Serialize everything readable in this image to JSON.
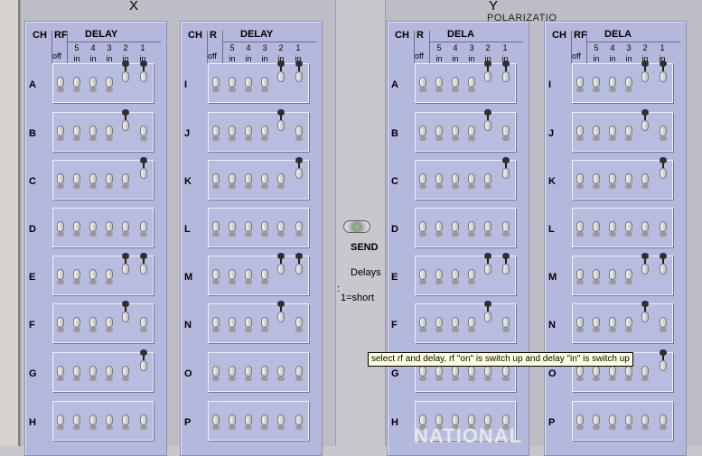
{
  "groups": [
    {
      "title": "X",
      "subtitle": ""
    },
    {
      "title": "Y",
      "subtitle": "POLARIZATIO"
    }
  ],
  "headers": {
    "ch": "CH",
    "off": "off",
    "delay": "DELAY",
    "delay_short": "DELA",
    "in": "in",
    "nums": [
      "5",
      "4",
      "3",
      "2",
      "1"
    ]
  },
  "panels": [
    {
      "rf": "RF",
      "delay": "DELAY",
      "rows": [
        {
          "label": "A",
          "switches": [
            "d",
            "d",
            "d",
            "d",
            "u",
            "u"
          ]
        },
        {
          "label": "B",
          "switches": [
            "d",
            "d",
            "d",
            "d",
            "u",
            "d"
          ]
        },
        {
          "label": "C",
          "switches": [
            "d",
            "d",
            "d",
            "d",
            "d",
            "u"
          ]
        },
        {
          "label": "D",
          "switches": [
            "d",
            "d",
            "d",
            "d",
            "d",
            "d"
          ]
        },
        {
          "label": "E",
          "switches": [
            "d",
            "d",
            "d",
            "d",
            "u",
            "u"
          ]
        },
        {
          "label": "F",
          "switches": [
            "d",
            "d",
            "d",
            "d",
            "u",
            "d"
          ]
        },
        {
          "label": "G",
          "switches": [
            "d",
            "d",
            "d",
            "d",
            "d",
            "u"
          ]
        },
        {
          "label": "H",
          "switches": [
            "d",
            "d",
            "d",
            "d",
            "d",
            "d"
          ]
        }
      ]
    },
    {
      "rf": "R",
      "delay": "DELAY",
      "rows": [
        {
          "label": "I",
          "switches": [
            "d",
            "d",
            "d",
            "d",
            "u",
            "u"
          ]
        },
        {
          "label": "J",
          "switches": [
            "d",
            "d",
            "d",
            "d",
            "u",
            "d"
          ]
        },
        {
          "label": "K",
          "switches": [
            "d",
            "d",
            "d",
            "d",
            "d",
            "u"
          ]
        },
        {
          "label": "L",
          "switches": [
            "d",
            "d",
            "d",
            "d",
            "d",
            "d"
          ]
        },
        {
          "label": "M",
          "switches": [
            "d",
            "d",
            "d",
            "d",
            "u",
            "u"
          ]
        },
        {
          "label": "N",
          "switches": [
            "d",
            "d",
            "d",
            "d",
            "u",
            "d"
          ]
        },
        {
          "label": "O",
          "switches": [
            "d",
            "d",
            "d",
            "d",
            "d",
            "d"
          ]
        },
        {
          "label": "P",
          "switches": [
            "d",
            "d",
            "d",
            "d",
            "d",
            "d"
          ]
        }
      ]
    },
    {
      "rf": "R",
      "delay": "DELA",
      "rows": [
        {
          "label": "A",
          "switches": [
            "d",
            "d",
            "d",
            "d",
            "u",
            "u"
          ]
        },
        {
          "label": "B",
          "switches": [
            "d",
            "d",
            "d",
            "d",
            "u",
            "d"
          ]
        },
        {
          "label": "C",
          "switches": [
            "d",
            "d",
            "d",
            "d",
            "d",
            "u"
          ]
        },
        {
          "label": "D",
          "switches": [
            "d",
            "d",
            "d",
            "d",
            "d",
            "d"
          ]
        },
        {
          "label": "E",
          "switches": [
            "d",
            "d",
            "d",
            "d",
            "u",
            "u"
          ]
        },
        {
          "label": "F",
          "switches": [
            "d",
            "d",
            "d",
            "d",
            "u",
            "d"
          ]
        },
        {
          "label": "G",
          "switches": [
            "d",
            "d",
            "d",
            "d",
            "d",
            "d"
          ]
        },
        {
          "label": "H",
          "switches": [
            "d",
            "d",
            "d",
            "d",
            "d",
            "d"
          ]
        }
      ]
    },
    {
      "rf": "RF",
      "delay": "DELA",
      "rows": [
        {
          "label": "I",
          "switches": [
            "d",
            "d",
            "d",
            "d",
            "u",
            "u"
          ]
        },
        {
          "label": "J",
          "switches": [
            "d",
            "d",
            "d",
            "d",
            "u",
            "d"
          ]
        },
        {
          "label": "K",
          "switches": [
            "d",
            "d",
            "d",
            "d",
            "d",
            "u"
          ]
        },
        {
          "label": "L",
          "switches": [
            "d",
            "d",
            "d",
            "d",
            "d",
            "d"
          ]
        },
        {
          "label": "M",
          "switches": [
            "d",
            "d",
            "d",
            "d",
            "u",
            "u"
          ]
        },
        {
          "label": "N",
          "switches": [
            "d",
            "d",
            "d",
            "d",
            "u",
            "d"
          ]
        },
        {
          "label": "O",
          "switches": [
            "d",
            "d",
            "d",
            "d",
            "d",
            "u"
          ]
        },
        {
          "label": "P",
          "switches": [
            "d",
            "d",
            "d",
            "d",
            "d",
            "d"
          ]
        }
      ]
    }
  ],
  "send": {
    "label": "SEND"
  },
  "legend": {
    "line1": "Delays",
    "line2": "1=short"
  },
  "tooltip": "select rf and delay, rf \"on\" is switch up and delay \"in\" is switch up",
  "logo": "NATIONAL"
}
